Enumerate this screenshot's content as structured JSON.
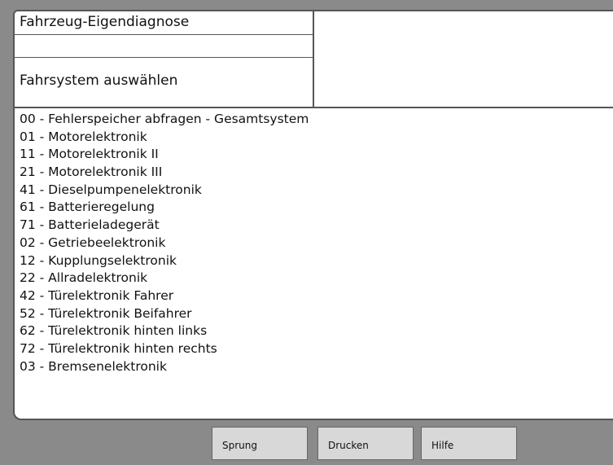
{
  "header": {
    "title": "Fahrzeug-Eigendiagnose",
    "subtitle": "Fahrsystem auswählen"
  },
  "systems": [
    "00 - Fehlerspeicher abfragen - Gesamtsystem",
    "01  - Motorelektronik",
    "11   - Motorelektronik II",
    "21  - Motorelektronik III",
    "41  - Dieselpumpenelektronik",
    "61  - Batterieregelung",
    "71  - Batterieladegerät",
    "02 - Getriebeelektronik",
    "12  - Kupplungselektronik",
    "22 - Allradelektronik",
    "42 - Türelektronik Fahrer",
    "52 - Türelektronik Beifahrer",
    "62 - Türelektronik hinten links",
    "72 - Türelektronik hinten rechts",
    "03 - Bremsenelektronik"
  ],
  "footer": {
    "sprung": "Sprung",
    "drucken": "Drucken",
    "hilfe": "Hilfe"
  }
}
